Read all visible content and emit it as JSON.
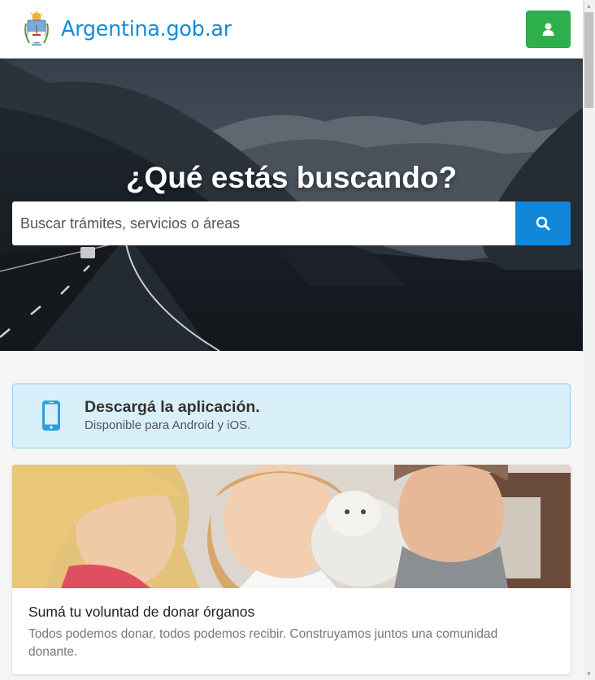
{
  "header": {
    "brand": "Argentina.gob.ar",
    "login_icon": "user-icon"
  },
  "hero": {
    "title": "¿Qué estás buscando?",
    "search_placeholder": "Buscar trámites, servicios o áreas",
    "search_icon": "search-icon"
  },
  "app_banner": {
    "icon": "mobile-phone-icon",
    "title": "Descargá la aplicación.",
    "subtitle": "Disponible para Android y iOS."
  },
  "card": {
    "title": "Sumá tu voluntad de donar órganos",
    "text": "Todos podemos donar, todos podemos recibir. Construyamos juntos una comunidad donante."
  },
  "colors": {
    "brand_blue": "#0d8ed8",
    "login_green": "#2eb14d",
    "search_blue": "#1087d8",
    "banner_bg": "#d9eff9"
  }
}
